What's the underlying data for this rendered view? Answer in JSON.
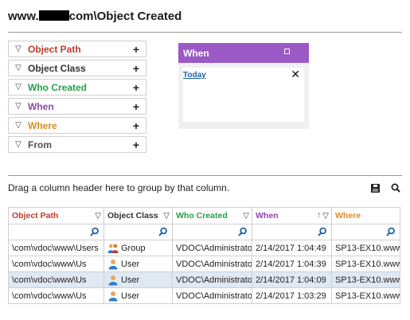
{
  "header": {
    "title_prefix": "www.",
    "title_suffix": "com\\Object Created"
  },
  "filters": [
    {
      "label": "Object Path",
      "color": "#c0392b"
    },
    {
      "label": "Object Class",
      "color": "#333333"
    },
    {
      "label": "Who Created",
      "color": "#27a04a"
    },
    {
      "label": "When",
      "color": "#8e44ad"
    },
    {
      "label": "Where",
      "color": "#e08a1e"
    },
    {
      "label": "From",
      "color": "#555555"
    }
  ],
  "when_panel": {
    "title": "When",
    "link": "Today",
    "header_color": "#9b59c5"
  },
  "grid": {
    "group_hint": "Drag a column header here to group by that column.",
    "columns": [
      {
        "label": "Object Path",
        "color": "#c0392b"
      },
      {
        "label": "Object Class",
        "color": "#333333"
      },
      {
        "label": "Who Created",
        "color": "#27a04a"
      },
      {
        "label": "When",
        "color": "#8e44ad"
      },
      {
        "label": "Where",
        "color": "#e08a1e"
      }
    ],
    "rows": [
      {
        "path": "\\com\\vdoc\\www\\Users",
        "cls": "Group",
        "icon": "group-icon",
        "who": "VDOC\\Administrator",
        "when": "2/14/2017 1:04:49",
        "where": "SP13-EX10.www"
      },
      {
        "path": "\\com\\vdoc\\www\\Us",
        "cls": "User",
        "icon": "user-icon",
        "who": "VDOC\\Administrator",
        "when": "2/14/2017 1:04:39",
        "where": "SP13-EX10.www"
      },
      {
        "path": "\\com\\vdoc\\www\\Us",
        "cls": "User",
        "icon": "user-icon",
        "who": "VDOC\\Administrator",
        "when": "2/14/2017 1:04:09",
        "where": "SP13-EX10.www"
      },
      {
        "path": "\\com\\vdoc\\www\\Us",
        "cls": "User",
        "icon": "user-icon",
        "who": "VDOC\\Administrator",
        "when": "2/14/2017 1:03:29",
        "where": "SP13-EX10.www"
      }
    ]
  }
}
